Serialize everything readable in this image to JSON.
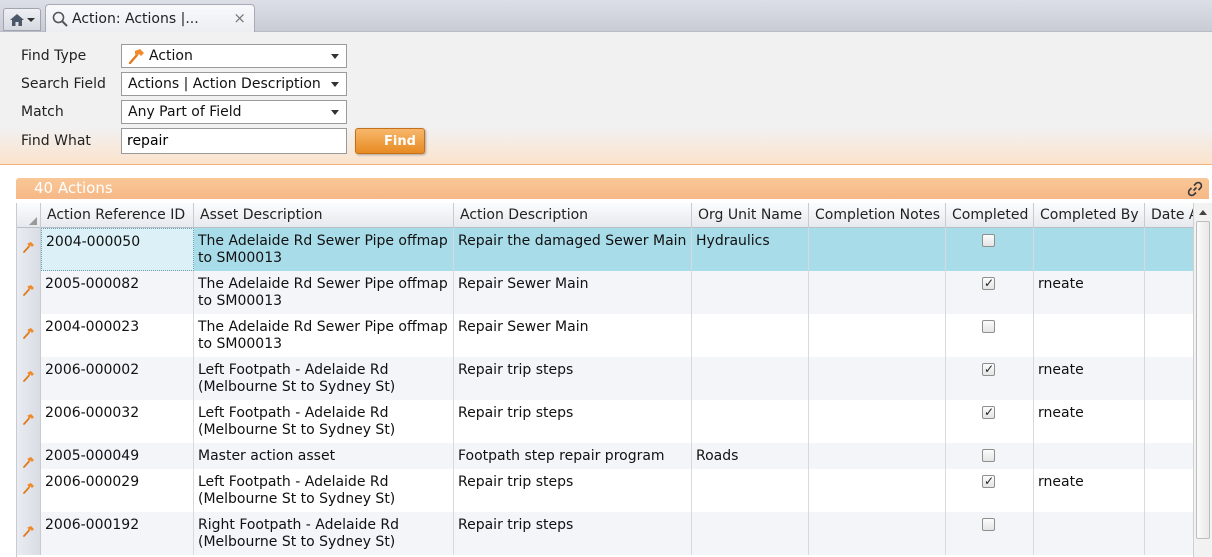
{
  "tab": {
    "title": "Action: Actions |...",
    "close": "×"
  },
  "form": {
    "find_type_label": "Find Type",
    "find_type_value": "Action",
    "search_field_label": "Search Field",
    "search_field_value": "Actions | Action Description",
    "match_label": "Match",
    "match_value": "Any Part of Field",
    "find_what_label": "Find What",
    "find_what_value": "repair",
    "find_button": "Find"
  },
  "results": {
    "count_label": "40 Actions"
  },
  "grid": {
    "columns": [
      "Action Reference ID",
      "Asset Description",
      "Action Description",
      "Org Unit Name",
      "Completion Notes",
      "Completed",
      "Completed By",
      "Date A"
    ],
    "rows": [
      {
        "ref": "2004-000050",
        "asset": "The Adelaide Rd Sewer Pipe offmap to SM00013",
        "action": "Repair the damaged Sewer Main",
        "org": "Hydraulics",
        "notes": "",
        "completed": false,
        "by": "",
        "date": ""
      },
      {
        "ref": "2005-000082",
        "asset": "The Adelaide Rd Sewer Pipe offmap to SM00013",
        "action": "Repair Sewer Main",
        "org": "",
        "notes": "",
        "completed": true,
        "by": "rneate",
        "date": ""
      },
      {
        "ref": "2004-000023",
        "asset": "The Adelaide Rd Sewer Pipe offmap to SM00013",
        "action": "Repair Sewer Main",
        "org": "",
        "notes": "",
        "completed": false,
        "by": "",
        "date": ""
      },
      {
        "ref": "2006-000002",
        "asset": "Left Footpath - Adelaide Rd (Melbourne St to Sydney St)",
        "action": "Repair trip steps",
        "org": "",
        "notes": "",
        "completed": true,
        "by": "rneate",
        "date": ""
      },
      {
        "ref": "2006-000032",
        "asset": "Left Footpath - Adelaide Rd (Melbourne St to Sydney St)",
        "action": "Repair trip steps",
        "org": "",
        "notes": "",
        "completed": true,
        "by": "rneate",
        "date": ""
      },
      {
        "ref": "2005-000049",
        "asset": "Master action asset",
        "action": "Footpath step repair program",
        "org": "Roads",
        "notes": "",
        "completed": false,
        "by": "",
        "date": ""
      },
      {
        "ref": "2006-000029",
        "asset": "Left Footpath - Adelaide Rd (Melbourne St to Sydney St)",
        "action": "Repair trip steps",
        "org": "",
        "notes": "",
        "completed": true,
        "by": "rneate",
        "date": ""
      },
      {
        "ref": "2006-000192",
        "asset": "Right Footpath - Adelaide Rd (Melbourne St to Sydney St)",
        "action": "Repair trip steps",
        "org": "",
        "notes": "",
        "completed": false,
        "by": "",
        "date": ""
      }
    ]
  },
  "colors": {
    "accent": "#f6b886",
    "selected_row": "#a9dce9"
  },
  "icons": {
    "home": "home-icon",
    "search": "search-icon",
    "action": "hammer-icon",
    "link": "link-icon"
  }
}
